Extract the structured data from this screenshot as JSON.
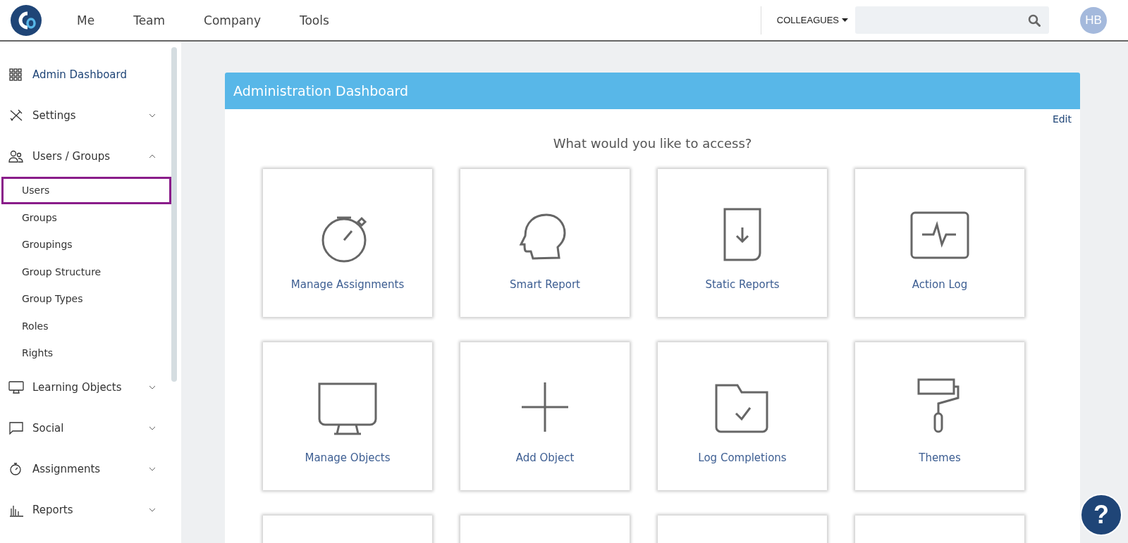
{
  "header": {
    "nav": [
      "Me",
      "Team",
      "Company",
      "Tools"
    ],
    "colleagues": "COLLEAGUES",
    "avatar": "HB"
  },
  "sidebar": {
    "items": [
      {
        "label": "Admin Dashboard",
        "selected": true
      },
      {
        "label": "Settings",
        "selected": false,
        "expanded": false
      },
      {
        "label": "Users / Groups",
        "selected": false,
        "expanded": true,
        "children": [
          {
            "label": "Users",
            "selected": true
          },
          {
            "label": "Groups",
            "selected": false
          },
          {
            "label": "Groupings",
            "selected": false
          },
          {
            "label": "Group Structure",
            "selected": false
          },
          {
            "label": "Group Types",
            "selected": false
          },
          {
            "label": "Roles",
            "selected": false
          },
          {
            "label": "Rights",
            "selected": false
          }
        ]
      },
      {
        "label": "Learning Objects",
        "selected": false,
        "expanded": false
      },
      {
        "label": "Social",
        "selected": false,
        "expanded": false
      },
      {
        "label": "Assignments",
        "selected": false,
        "expanded": false
      },
      {
        "label": "Reports",
        "selected": false,
        "expanded": false
      }
    ]
  },
  "panel": {
    "title": "Administration Dashboard",
    "edit": "Edit",
    "question": "What would you like to access?",
    "tiles": [
      "Manage Assignments",
      "Smart Report",
      "Static Reports",
      "Action Log",
      "Manage Objects",
      "Add Object",
      "Log Completions",
      "Themes"
    ]
  },
  "help": "?"
}
